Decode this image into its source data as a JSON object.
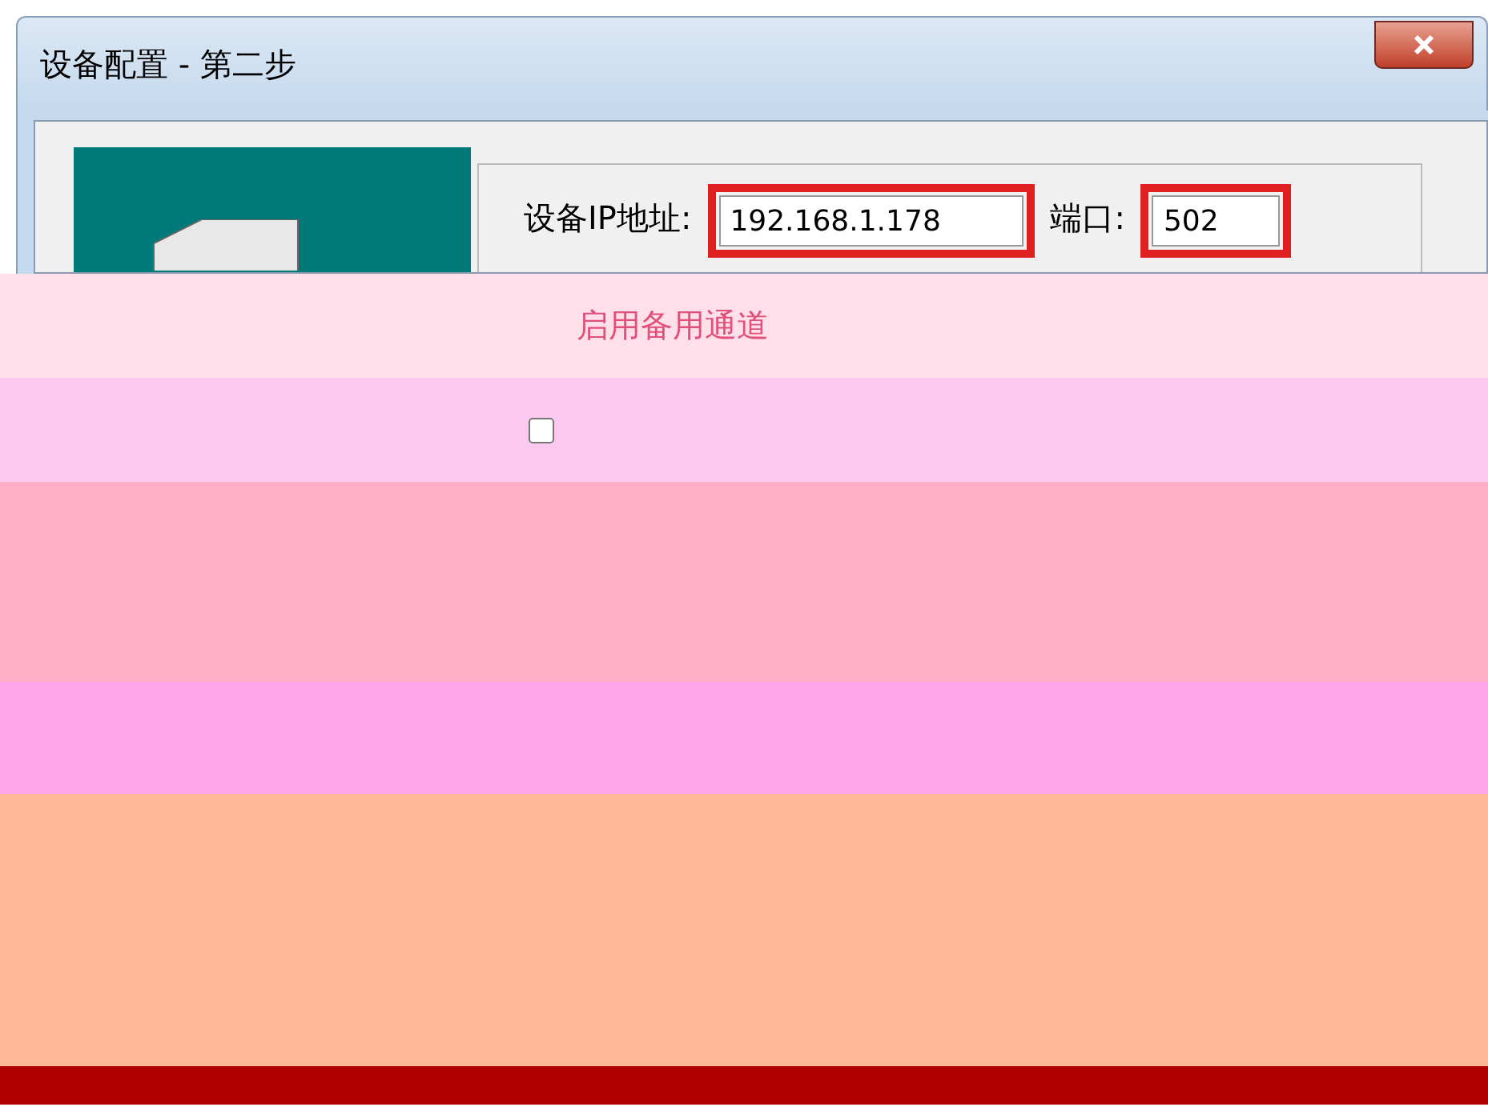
{
  "window": {
    "title": "设备配置 - 第二步"
  },
  "fields": [
    {
      "label": "设备IP地址:",
      "value": "192.168.1.178"
    },
    {
      "label": "端口:",
      "value": "502"
    }
  ],
  "backup_channel": {
    "label": "启用备用通道"
  },
  "option": {
    "checked": false
  }
}
